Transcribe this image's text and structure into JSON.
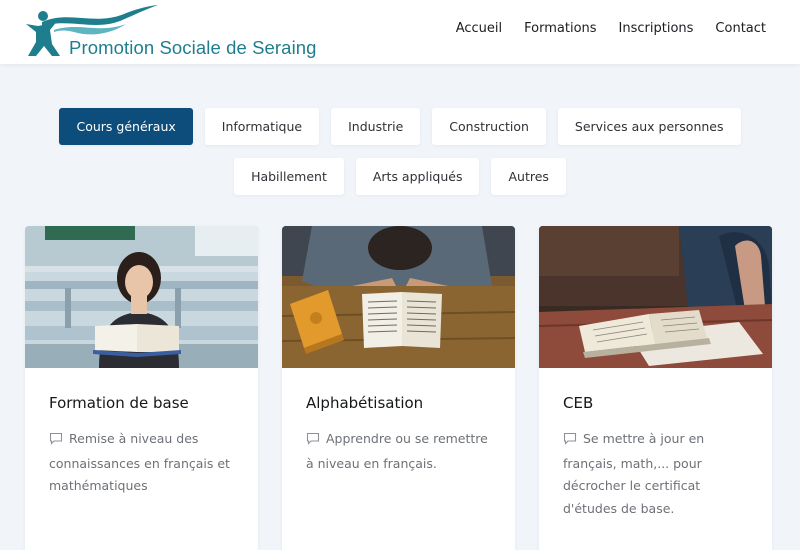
{
  "header": {
    "logo_text": "Promotion Sociale de Seraing",
    "nav": [
      "Accueil",
      "Formations",
      "Inscriptions",
      "Contact"
    ]
  },
  "filters": {
    "row1": [
      "Cours généraux",
      "Informatique",
      "Industrie",
      "Construction",
      "Services aux personnes"
    ],
    "row2": [
      "Habillement",
      "Arts appliqués",
      "Autres"
    ],
    "active": "Cours généraux"
  },
  "cards": [
    {
      "title": "Formation de base",
      "description": "Remise à niveau des connaissances en français et mathématiques",
      "icon": "comment-icon"
    },
    {
      "title": "Alphabétisation",
      "description": "Apprendre ou se remettre à niveau en français.",
      "icon": "comment-icon"
    },
    {
      "title": "CEB",
      "description": "Se mettre à jour en français, math,... pour décrocher le certificat d'études de base.",
      "icon": "comment-icon"
    }
  ],
  "colors": {
    "brand": "#1f7e8e",
    "active_tab": "#0d4d7c",
    "page_bg": "#f1f4f9"
  }
}
